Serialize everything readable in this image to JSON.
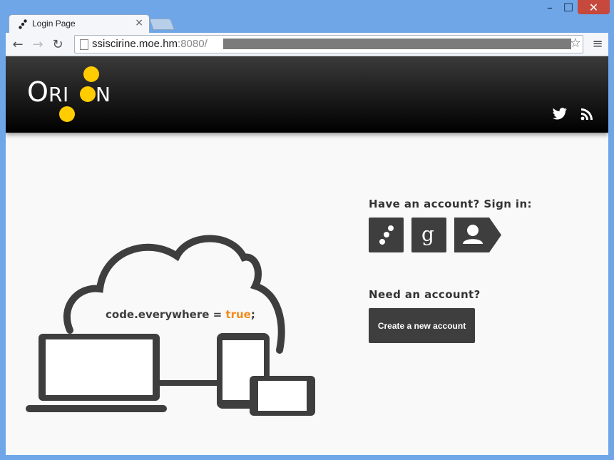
{
  "browser": {
    "tab_title": "Login Page",
    "tab_close": "×",
    "url_host": "ssiscirine.moe.hm",
    "url_port": ":8080/",
    "window_min": "–",
    "window_max": "☐",
    "window_close": "✕"
  },
  "header": {
    "logo_text": "ORION"
  },
  "signin": {
    "heading": "Have an account? Sign in:"
  },
  "signup": {
    "heading": "Need an account?",
    "create_label": "Create a new account"
  },
  "illustration": {
    "slogan_prefix": "code.everywhere = ",
    "slogan_value": "true",
    "slogan_suffix": ";"
  },
  "colors": {
    "accent": "#ffcc00",
    "slogan_true": "#f28c1e",
    "button_bg": "#3e3e3e"
  }
}
